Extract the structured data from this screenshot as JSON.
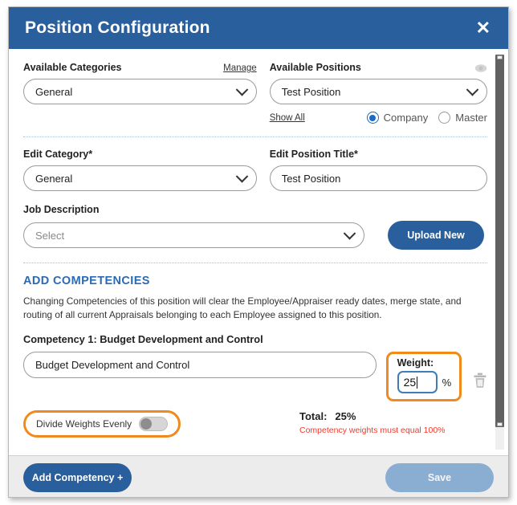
{
  "dialog": {
    "title": "Position Configuration",
    "close_icon": "close-icon"
  },
  "categories": {
    "label": "Available Categories",
    "manage_link": "Manage",
    "value": "General"
  },
  "positions": {
    "label": "Available Positions",
    "value": "Test Position",
    "show_all_link": "Show All",
    "scope_options": [
      {
        "label": "Company",
        "selected": true
      },
      {
        "label": "Master",
        "selected": false
      }
    ]
  },
  "edit_category": {
    "label": "Edit Category*",
    "value": "General"
  },
  "edit_position_title": {
    "label": "Edit Position Title*",
    "value": "Test Position"
  },
  "job_description": {
    "label": "Job Description",
    "placeholder": "Select",
    "upload_button": "Upload New"
  },
  "competencies": {
    "section_title": "ADD COMPETENCIES",
    "description": "Changing Competencies of this position will clear the Employee/Appraiser ready dates, merge state, and routing of all current Appraisals belonging to each Employee assigned to this position.",
    "item_label": "Competency 1: Budget Development and Control",
    "item_value": "Budget Development and Control",
    "weight_label": "Weight:",
    "weight_value": "25",
    "percent_symbol": "%",
    "delete_icon": "trash-icon",
    "divide_evenly_label": "Divide Weights Evenly",
    "divide_evenly_on": false,
    "total_label": "Total:",
    "total_value": "25%",
    "error_message": "Competency weights must equal 100%"
  },
  "footer": {
    "add_competency": "Add Competency +",
    "save": "Save"
  },
  "colors": {
    "header_blue": "#2a5f9e",
    "accent_orange": "#f08a1d",
    "error_red": "#f03a2e",
    "section_blue": "#2a6bb5",
    "save_disabled": "#8aaed2"
  }
}
